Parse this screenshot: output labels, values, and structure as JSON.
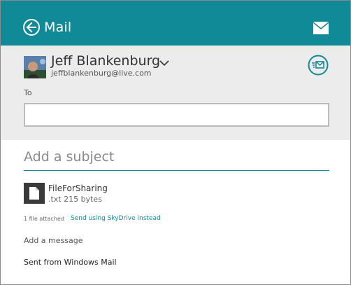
{
  "header": {
    "title": "Mail",
    "back_icon": "back-arrow-icon",
    "mail_icon": "envelope-icon",
    "color": "#0f8a96"
  },
  "sender": {
    "name": "Jeff Blankenburg",
    "email": "jeffblankenburg@live.com",
    "chevron_icon": "chevron-down-icon",
    "send_icon": "send-icon"
  },
  "to": {
    "label": "To",
    "value": ""
  },
  "subject": {
    "placeholder": "Add a subject",
    "value": ""
  },
  "attachment": {
    "file_name": "FileForSharing",
    "file_meta": ".txt 215 bytes",
    "file_icon": "document-icon",
    "count_text": "1 file attached",
    "skydrive_link": "Send using SkyDrive instead"
  },
  "message": {
    "placeholder": "Add a message",
    "signature": "Sent from Windows Mail"
  }
}
